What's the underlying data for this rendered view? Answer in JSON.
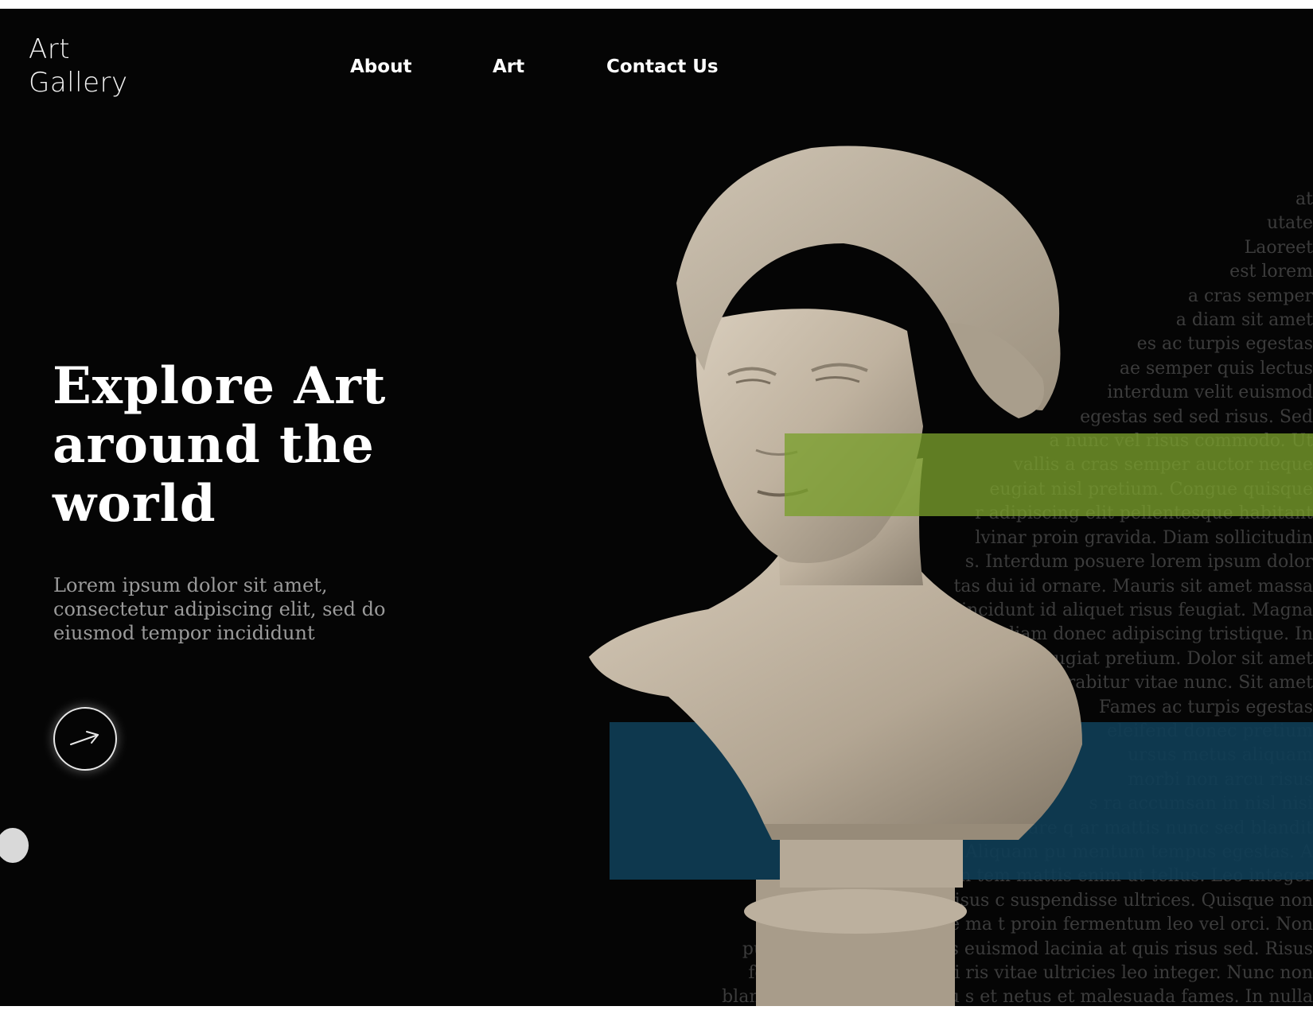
{
  "brand": {
    "line1": "Art",
    "line2": "Gallery"
  },
  "nav": {
    "items": [
      {
        "label": "About"
      },
      {
        "label": "Art"
      },
      {
        "label": "Contact Us"
      }
    ]
  },
  "hero": {
    "title_lines": [
      "Explore Art",
      "around the",
      "world"
    ],
    "subtitle": "Lorem ipsum dolor sit amet, consectetur adipiscing elit, sed do eiusmod tempor incididunt",
    "cta_icon": "arrow-right-icon"
  },
  "background_text": [
    "at",
    "utate",
    "Laoreet",
    "est lorem",
    "a cras semper",
    "a diam sit amet",
    "es ac turpis egestas",
    "ae semper quis lectus",
    "interdum velit euismod",
    "egestas sed sed risus. Sed",
    "a nunc vel risus commodo. Ut",
    "vallis a cras semper auctor neque",
    "eugiat nisl pretium. Congue quisque",
    "r adipiscing elit pellentesque habitant",
    "lvinar proin gravida. Diam sollicitudin",
    "s. Interdum posuere lorem ipsum dolor",
    "tas dui id ornare. Mauris sit amet massa",
    "tincidunt id aliquet risus feugiat. Magna",
    "ng diam donec adipiscing tristique. In",
    "eu feugiat pretium. Dolor sit amet",
    "urabitur vitae nunc. Sit amet",
    "Fames ac turpis egestas",
    "eleifend donec pretium",
    "ursus metus aliquam",
    "morbi non arcu risus",
    "s ra accumsan in nisl nisi",
    "ornare q ar mattis nunc sed blandit",
    "Aliquam pu mentum tempus egestas. A",
    "ollicitudin tem mattis enim ut tellus. Leo integer",
    "a nunc vel risus c suspendisse ultrices. Quisque non",
    "ac auctor augue ma t proin fermentum leo vel orci. Non",
    "pulvinar neque laoreet s euismod lacinia at quis risus sed. Risus",
    "feugiat in ante metus di ris vitae ultricies leo integer. Nunc non",
    "blandit massa enim nec du s et netus et malesuada fames. In nulla"
  ],
  "colors": {
    "background": "#050505",
    "green_overlay": "#7a9f2b",
    "blue_overlay": "#0f3d55",
    "text": "#ffffff",
    "muted": "#9a9a9a"
  }
}
